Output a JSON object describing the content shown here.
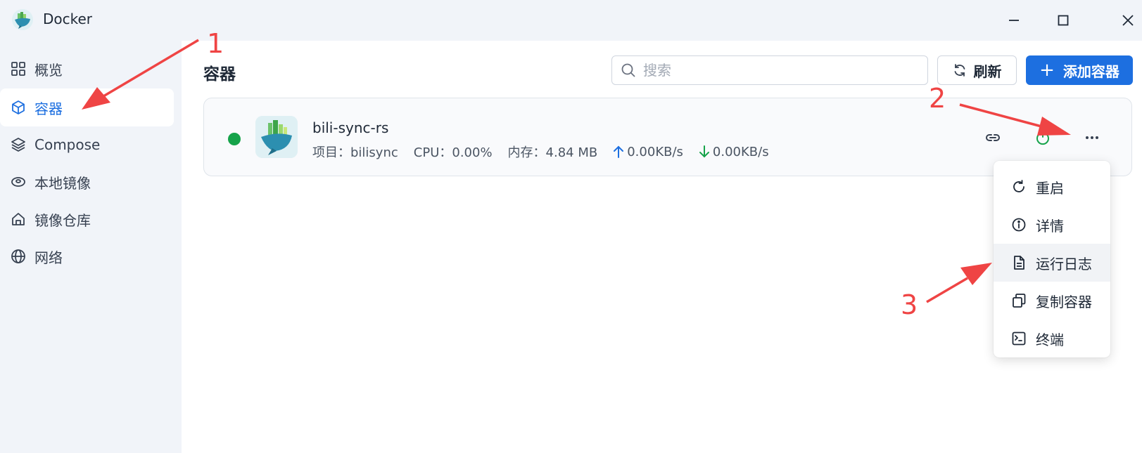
{
  "window": {
    "title": "Docker",
    "controls": {
      "minimize": "minimize-icon",
      "maximize": "maximize-icon",
      "close": "close-icon"
    }
  },
  "sidebar": {
    "items": [
      {
        "label": "概览",
        "icon": "grid-icon",
        "active": false
      },
      {
        "label": "容器",
        "icon": "box-icon",
        "active": true
      },
      {
        "label": "Compose",
        "icon": "layers-icon",
        "active": false
      },
      {
        "label": "本地镜像",
        "icon": "disk-icon",
        "active": false
      },
      {
        "label": "镜像仓库",
        "icon": "home-icon",
        "active": false
      },
      {
        "label": "网络",
        "icon": "globe-icon",
        "active": false
      }
    ]
  },
  "header": {
    "title": "容器",
    "search_placeholder": "搜索",
    "refresh_label": "刷新",
    "add_label": "添加容器"
  },
  "container": {
    "name": "bili-sync-rs",
    "status": "running",
    "project": "项目：bilisync",
    "cpu": "CPU：0.00%",
    "memory": "内存：4.84 MB",
    "upload": "0.00KB/s",
    "download": "0.00KB/s",
    "status_color": "#16a34a"
  },
  "context_menu": {
    "items": [
      {
        "label": "重启",
        "icon": "restart-icon"
      },
      {
        "label": "详情",
        "icon": "info-icon"
      },
      {
        "label": "运行日志",
        "icon": "log-file-icon",
        "hover": true
      },
      {
        "label": "复制容器",
        "icon": "copy-icon"
      },
      {
        "label": "终端",
        "icon": "terminal-icon"
      }
    ]
  },
  "annotations": {
    "step1": "1",
    "step2": "2",
    "step3": "3"
  },
  "colors": {
    "accent": "#1d6fe0",
    "annotation": "#ef4444",
    "sidebar_bg": "#f1f4f9"
  }
}
